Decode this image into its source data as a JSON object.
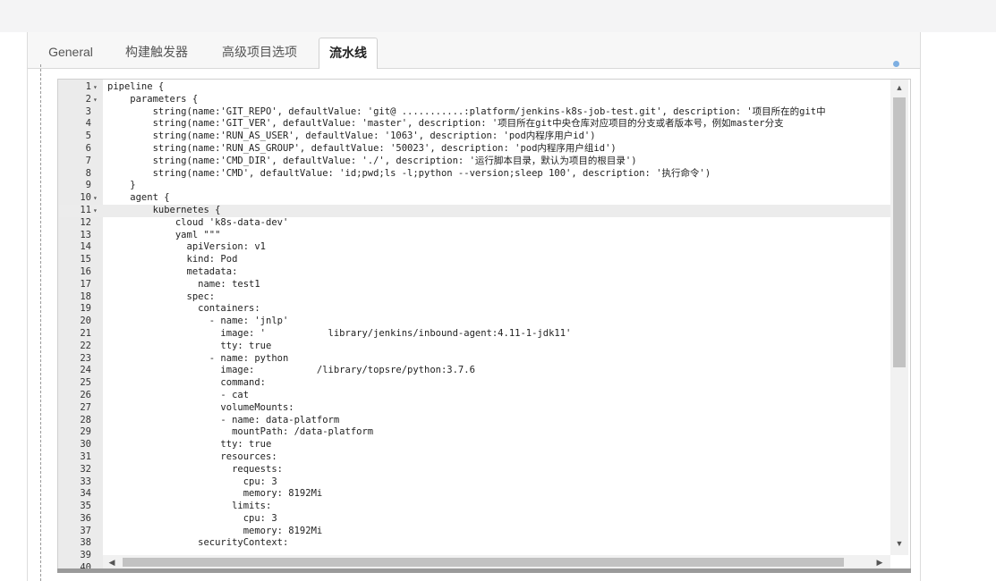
{
  "tabs": [
    {
      "label": "General",
      "active": false
    },
    {
      "label": "构建触发器",
      "active": false
    },
    {
      "label": "高级项目选项",
      "active": false
    },
    {
      "label": "流水线",
      "active": true
    }
  ],
  "editor": {
    "active_line": 11,
    "lines": [
      {
        "n": "1",
        "fold": true,
        "text": "pipeline {"
      },
      {
        "n": "2",
        "fold": true,
        "text": "    parameters {"
      },
      {
        "n": "3",
        "fold": false,
        "text": "        string(name:'GIT_REPO', defaultValue: 'git@ ...........:platform/jenkins-k8s-job-test.git', description: '项目所在的git中"
      },
      {
        "n": "4",
        "fold": false,
        "text": "        string(name:'GIT_VER', defaultValue: 'master', description: '项目所在git中央仓库对应项目的分支或者版本号，例如master分支"
      },
      {
        "n": "5",
        "fold": false,
        "text": "        string(name:'RUN_AS_USER', defaultValue: '1063', description: 'pod内程序用户id')"
      },
      {
        "n": "6",
        "fold": false,
        "text": "        string(name:'RUN_AS_GROUP', defaultValue: '50023', description: 'pod内程序用户组id')"
      },
      {
        "n": "7",
        "fold": false,
        "text": "        string(name:'CMD_DIR', defaultValue: './', description: '运行脚本目录，默认为项目的根目录')"
      },
      {
        "n": "8",
        "fold": false,
        "text": "        string(name:'CMD', defaultValue: 'id;pwd;ls -l;python --version;sleep 100', description: '执行命令')"
      },
      {
        "n": "9",
        "fold": false,
        "text": "    }"
      },
      {
        "n": "10",
        "fold": true,
        "text": "    agent {"
      },
      {
        "n": "11",
        "fold": true,
        "text": "        kubernetes {"
      },
      {
        "n": "12",
        "fold": false,
        "text": "            cloud 'k8s-data-dev'"
      },
      {
        "n": "13",
        "fold": false,
        "text": "            yaml \"\"\""
      },
      {
        "n": "14",
        "fold": false,
        "text": "              apiVersion: v1"
      },
      {
        "n": "15",
        "fold": false,
        "text": "              kind: Pod"
      },
      {
        "n": "16",
        "fold": false,
        "text": "              metadata:"
      },
      {
        "n": "17",
        "fold": false,
        "text": "                name: test1"
      },
      {
        "n": "18",
        "fold": false,
        "text": "              spec:"
      },
      {
        "n": "19",
        "fold": false,
        "text": "                containers:"
      },
      {
        "n": "20",
        "fold": false,
        "text": "                  - name: 'jnlp'"
      },
      {
        "n": "21",
        "fold": false,
        "text": "                    image: '           library/jenkins/inbound-agent:4.11-1-jdk11'"
      },
      {
        "n": "22",
        "fold": false,
        "text": "                    tty: true"
      },
      {
        "n": "23",
        "fold": false,
        "text": "                  - name: python"
      },
      {
        "n": "24",
        "fold": false,
        "text": "                    image:           /library/topsre/python:3.7.6"
      },
      {
        "n": "25",
        "fold": false,
        "text": "                    command:"
      },
      {
        "n": "26",
        "fold": false,
        "text": "                    - cat"
      },
      {
        "n": "27",
        "fold": false,
        "text": "                    volumeMounts:"
      },
      {
        "n": "28",
        "fold": false,
        "text": "                    - name: data-platform"
      },
      {
        "n": "29",
        "fold": false,
        "text": "                      mountPath: /data-platform"
      },
      {
        "n": "30",
        "fold": false,
        "text": "                    tty: true"
      },
      {
        "n": "31",
        "fold": false,
        "text": "                    resources:"
      },
      {
        "n": "32",
        "fold": false,
        "text": "                      requests:"
      },
      {
        "n": "33",
        "fold": false,
        "text": "                        cpu: 3"
      },
      {
        "n": "34",
        "fold": false,
        "text": "                        memory: 8192Mi"
      },
      {
        "n": "35",
        "fold": false,
        "text": "                      limits:"
      },
      {
        "n": "36",
        "fold": false,
        "text": "                        cpu: 3"
      },
      {
        "n": "37",
        "fold": false,
        "text": "                        memory: 8192Mi"
      },
      {
        "n": "38",
        "fold": false,
        "text": "                securityContext:"
      },
      {
        "n": "39",
        "fold": false,
        "text": ""
      },
      {
        "n": "40",
        "fold": false,
        "text": ""
      }
    ]
  },
  "icons": {
    "fold": "▾",
    "scroll_up": "▲",
    "scroll_down": "▼",
    "scroll_left": "◀",
    "scroll_right": "▶"
  }
}
